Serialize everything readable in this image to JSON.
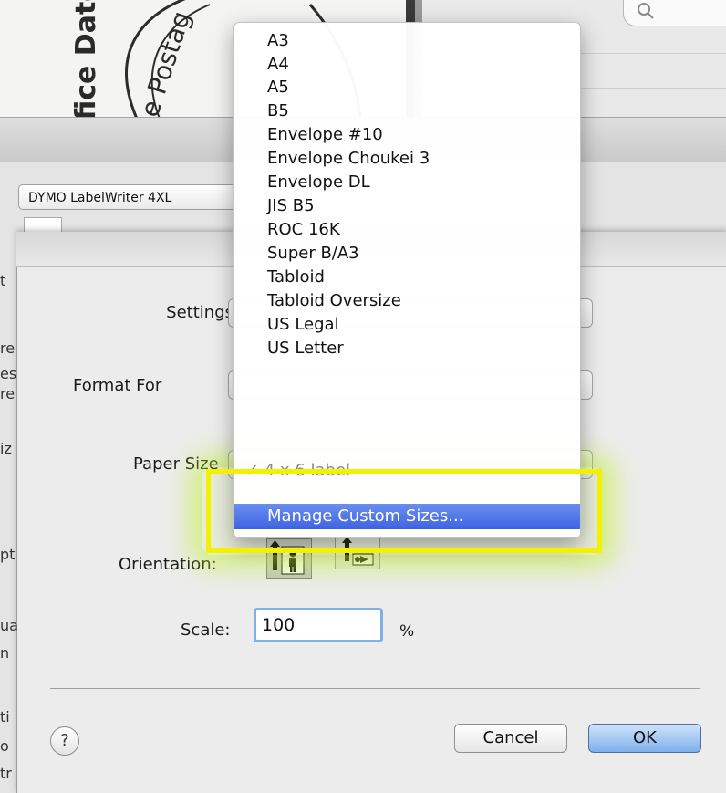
{
  "background": {
    "stamp_lines": [
      "fice Date",
      "e Postag"
    ],
    "printer_name": "DYMO LabelWriter 4XL",
    "left_fragments": [
      "t",
      "re",
      "es",
      "re",
      "iz",
      "pt",
      "ua",
      "n",
      "ti",
      "o",
      "tr"
    ]
  },
  "page_setup": {
    "settings_label": "Settings",
    "format_for_label": "Format For",
    "paper_size_label": "Paper Size",
    "paper_size_value": "4 x 6 label",
    "orientation_label": "Orientation:",
    "scale_label": "Scale:",
    "scale_value": "100",
    "scale_unit": "%",
    "help_label": "?",
    "cancel_label": "Cancel",
    "ok_label": "OK"
  },
  "paper_menu": {
    "items": [
      "A3",
      "A4",
      "A5",
      "B5",
      "Envelope #10",
      "Envelope Choukei 3",
      "Envelope DL",
      "JIS B5",
      "ROC 16K",
      "Super B/A3",
      "Tabloid",
      "Tabloid Oversize",
      "US Legal",
      "US Letter"
    ],
    "current_item": "✓  4 x 6 label",
    "manage_label": "Manage Custom Sizes..."
  },
  "annotation": {
    "highlight_color": "#f2f200",
    "glow_color": "#bef028"
  },
  "icons": {
    "search": "search-icon",
    "portrait": "portrait-orientation-icon",
    "landscape": "landscape-orientation-icon",
    "checkmark": "checkmark-icon"
  }
}
